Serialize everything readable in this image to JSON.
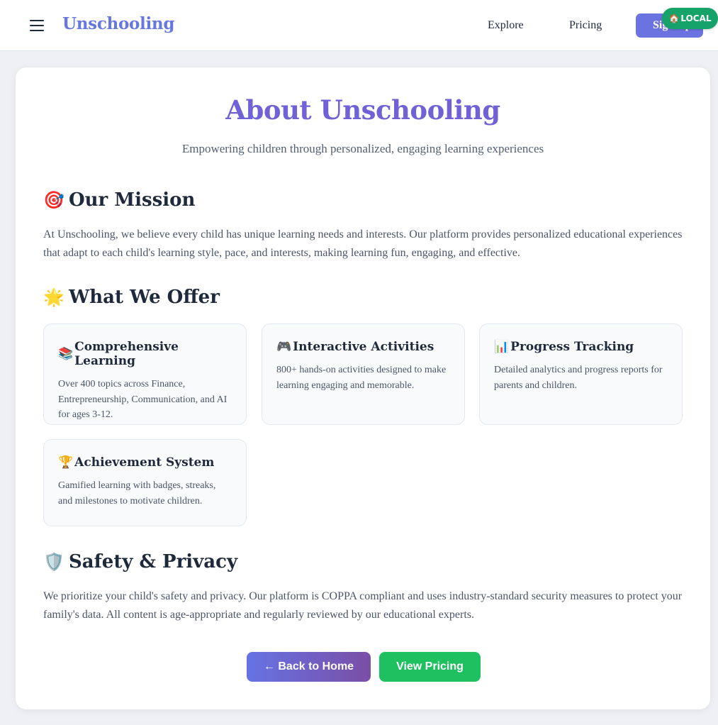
{
  "header": {
    "brand": "Unschooling",
    "nav": [
      "Explore",
      "Pricing"
    ],
    "signup_label": "Sign Up",
    "local_badge": "LOCAL",
    "local_icon": "🏠"
  },
  "main": {
    "title": "About Unschooling",
    "subtitle": "Empowering children through personalized, engaging learning experiences",
    "mission": {
      "icon": "🎯",
      "heading": "Our Mission",
      "text": "At Unschooling, we believe every child has unique learning needs and interests. Our platform provides personalized educational experiences that adapt to each child's learning style, pace, and interests, making learning fun, engaging, and effective."
    },
    "offer": {
      "icon": "🌟",
      "heading": "What We Offer",
      "cards": [
        {
          "icon": "📚",
          "title": "Comprehensive Learning",
          "desc": "Over 400 topics across Finance, Entrepreneurship, Communication, and AI for ages 3-12."
        },
        {
          "icon": "🎮",
          "title": "Interactive Activities",
          "desc": "800+ hands-on activities designed to make learning engaging and memorable."
        },
        {
          "icon": "📊",
          "title": "Progress Tracking",
          "desc": "Detailed analytics and progress reports for parents and children."
        },
        {
          "icon": "🏆",
          "title": "Achievement System",
          "desc": "Gamified learning with badges, streaks, and milestones to motivate children."
        }
      ]
    },
    "safety": {
      "icon": "🛡️",
      "heading": "Safety & Privacy",
      "text": "We prioritize your child's safety and privacy. Our platform is COPPA compliant and uses industry-standard security measures to protect your family's data. All content is age-appropriate and regularly reviewed by our educational experts."
    },
    "buttons": {
      "home": "← Back to Home",
      "pricing": "View Pricing"
    }
  },
  "colors": {
    "brand": "#6777e0",
    "title": "#7062d6",
    "signup": "#6b73e0",
    "local_badge": "#16a36a",
    "pricing_button": "#1fc05f"
  }
}
